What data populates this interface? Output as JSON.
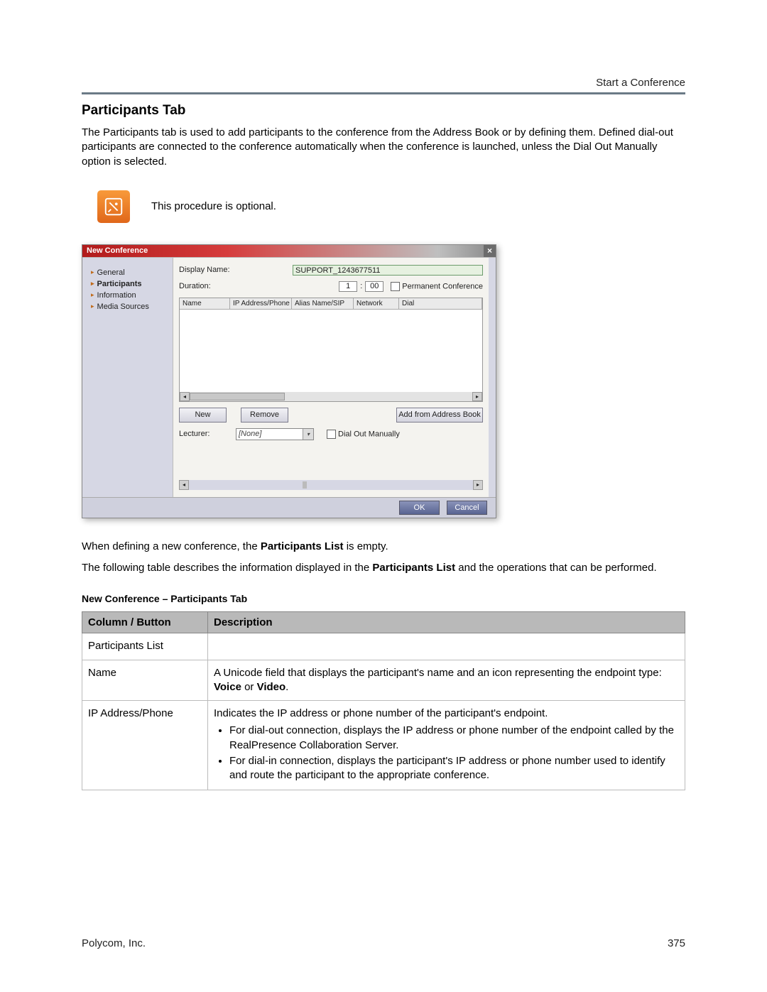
{
  "header": {
    "right": "Start a Conference"
  },
  "section": {
    "title": "Participants Tab",
    "intro": "The Participants tab is used to add participants to the conference from the Address Book or by defining them. Defined dial-out participants are connected to the conference automatically when the conference is launched, unless the Dial Out Manually option is selected."
  },
  "note": {
    "text": "This procedure is optional."
  },
  "dialog": {
    "title": "New Conference",
    "nav": {
      "general": "General",
      "participants": "Participants",
      "information": "Information",
      "media_sources": "Media Sources"
    },
    "fields": {
      "display_name_label": "Display Name:",
      "display_name_value": "SUPPORT_1243677511",
      "duration_label": "Duration:",
      "duration_h": "1",
      "duration_sep": ":",
      "duration_m": "00",
      "permanent_conf": "Permanent Conference"
    },
    "grid_headers": {
      "name": "Name",
      "ip": "IP Address/Phone",
      "alias": "Alias Name/SIP",
      "network": "Network",
      "dial": "Dial"
    },
    "buttons": {
      "new": "New",
      "remove": "Remove",
      "add_from_ab": "Add from Address Book"
    },
    "lecturer": {
      "label": "Lecturer:",
      "value": "[None]",
      "dial_out_manually": "Dial Out Manually"
    },
    "footer": {
      "ok": "OK",
      "cancel": "Cancel"
    }
  },
  "after": {
    "p1a": "When defining a new conference, the ",
    "p1b": "Participants List",
    "p1c": " is empty.",
    "p2a": "The following table describes the information displayed in the ",
    "p2b": "Participants List",
    "p2c": " and the operations that can be performed."
  },
  "table": {
    "title": "New Conference – Participants Tab",
    "h1": "Column / Button",
    "h2": "Description",
    "r1c1": "Participants List",
    "r1c2": "",
    "r2c1": "Name",
    "r2c2a": "A Unicode field that displays the participant's name and an icon representing the endpoint type: ",
    "r2c2b": "Voice",
    "r2c2c": " or ",
    "r2c2d": "Video",
    "r2c2e": ".",
    "r3c1": "IP Address/Phone",
    "r3c2_lead": "Indicates the IP address or phone number of the participant's endpoint.",
    "r3c2_b1": "For dial-out connection, displays the IP address or phone number of the endpoint called by the RealPresence Collaboration Server.",
    "r3c2_b2": "For dial-in connection, displays the participant's IP address or phone number used to identify and route the participant to the appropriate conference."
  },
  "page_footer": {
    "left": "Polycom, Inc.",
    "right": "375"
  }
}
